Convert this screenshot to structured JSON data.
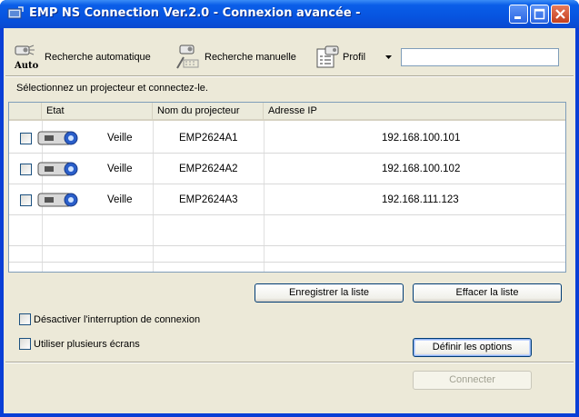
{
  "window": {
    "title": "EMP NS Connection Ver.2.0 - Connexion avancée -"
  },
  "toolbar": {
    "auto_search": {
      "label": "Recherche automatique",
      "icon": "auto-search-icon",
      "icon_text": "Auto"
    },
    "manual_search": {
      "label": "Recherche manuelle",
      "icon": "manual-search-icon"
    },
    "profile": {
      "label": "Profil",
      "icon": "profile-icon"
    },
    "combo_value": ""
  },
  "instruction": "Sélectionnez un projecteur et connectez-le.",
  "list": {
    "columns": [
      "Etat",
      "Nom du projecteur",
      "Adresse IP"
    ],
    "rows": [
      {
        "checked": false,
        "status": "Veille",
        "name": "EMP2624A1",
        "ip": "192.168.100.101"
      },
      {
        "checked": false,
        "status": "Veille",
        "name": "EMP2624A2",
        "ip": "192.168.100.102"
      },
      {
        "checked": false,
        "status": "Veille",
        "name": "EMP2624A3",
        "ip": "192.168.111.123"
      }
    ]
  },
  "buttons": {
    "save_list": "Enregistrer la liste",
    "clear_list": "Effacer la liste",
    "set_options": "Définir les options",
    "connect": "Connecter"
  },
  "options": {
    "disable_interrupt": {
      "label": "Désactiver l'interruption de connexion",
      "checked": false
    },
    "multi_screen": {
      "label": "Utiliser plusieurs écrans",
      "checked": false
    }
  },
  "colors": {
    "titlebar": "#0754e0",
    "client": "#ece9d8",
    "close": "#c4401e"
  }
}
